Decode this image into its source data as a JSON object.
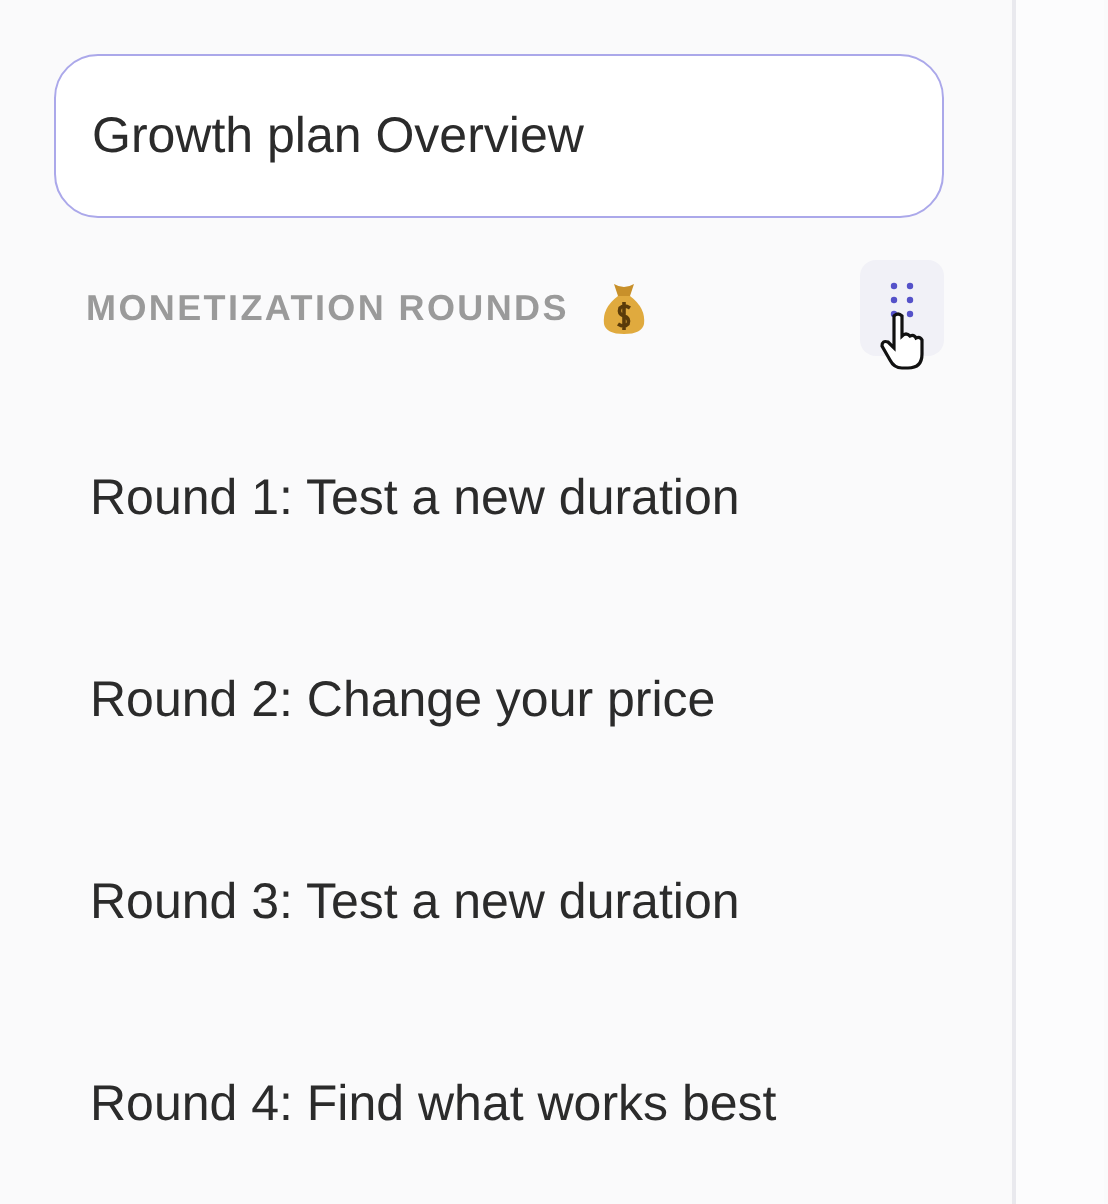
{
  "title_field": {
    "value": "Growth plan Overview"
  },
  "section": {
    "title": "MONETIZATION ROUNDS"
  },
  "rounds": [
    {
      "label": "Round 1: Test a new duration"
    },
    {
      "label": "Round 2: Change your price"
    },
    {
      "label": "Round 3: Test a new duration"
    },
    {
      "label": "Round 4: Find what works best"
    }
  ]
}
